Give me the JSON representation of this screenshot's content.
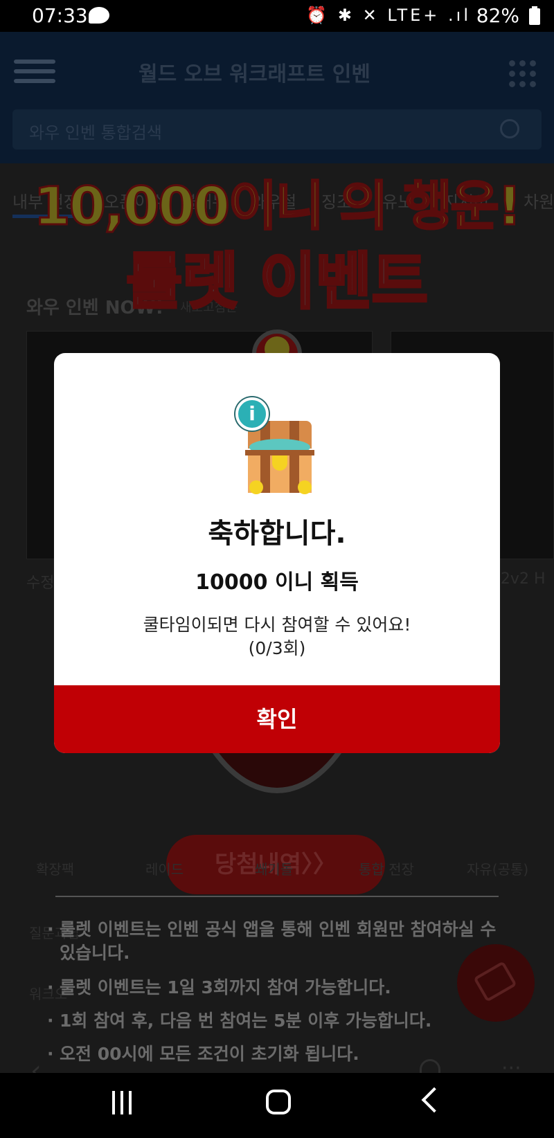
{
  "status_bar": {
    "time": "07:33",
    "icons": "⏰ ✱ ✕ LTE+ .ıl",
    "battery": "82%"
  },
  "app": {
    "title": "월드 오브 워크래프트 인벤",
    "search_placeholder": "와우 인벤 통합검색",
    "tabs": [
      "내부 전장",
      "오픈이슈",
      "불매뉴",
      "와우절",
      "징조",
      "유노",
      "지시어",
      "차원"
    ],
    "now_title": "와우 인벤 NOW!",
    "now_sub": "새로고침문",
    "card_left_caption": "수정",
    "card_right_caption": "- 2v2 H",
    "bottom_tabs": [
      "확장팩",
      "레이드",
      "쐐기돌",
      "통합 전장",
      "자유(공통)"
    ],
    "bg_rows": [
      "질문과답",
      "워크오"
    ]
  },
  "event": {
    "title_line1": "10,000이니 의 행운!",
    "title_line2": "룰렛 이벤트",
    "history_button": "당첨내역〉〉",
    "notices": [
      "룰렛 이벤트는 인벤 공식 앱을 통해 인벤 회원만 참여하실 수 있습니다.",
      "룰렛 이벤트는 1일 3회까지 참여 가능합니다.",
      "1회 참여 후, 다음 번 참여는  5분 이후 가능합니다.",
      "오전 00시에 모든 조건이 초기화 됩니다."
    ]
  },
  "modal": {
    "badge": "i",
    "title": "축하합니다.",
    "reward": "10000 이니 획득",
    "message_line1": "쿨타임이되면 다시 참여할 수 있어요!",
    "message_line2": "(0/3회)",
    "confirm_label": "확인"
  },
  "colors": {
    "confirm_button": "#c00005",
    "modal_bg": "#ffffff"
  }
}
